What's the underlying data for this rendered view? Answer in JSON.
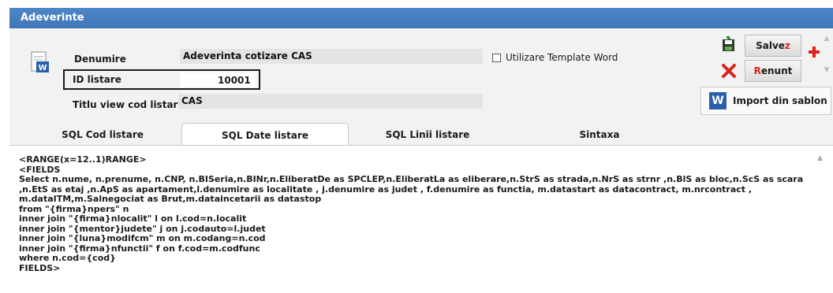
{
  "window": {
    "title": "Adeverinte"
  },
  "form": {
    "denumire_label": "Denumire",
    "denumire_value": "Adeverinta cotizare CAS",
    "id_label": "ID listare",
    "id_value": "10001",
    "titlu_label": "Titlu view cod listare",
    "titlu_value": "CAS",
    "template_label": "Utilizare Template Word",
    "template_checked": false
  },
  "buttons": {
    "save_pre": "Salve",
    "save_hot": "z",
    "cancel_hot": "R",
    "cancel_post": "enunt",
    "import_label": "Import din sablon",
    "import_icon_letter": "W"
  },
  "tabs": [
    {
      "label": "SQL Cod listare",
      "active": false
    },
    {
      "label": "SQL Date listare",
      "active": true
    },
    {
      "label": "SQL Linii listare",
      "active": false
    },
    {
      "label": "Sintaxa",
      "active": false
    }
  ],
  "sql": {
    "lines": [
      "<RANGE(x=12..1)RANGE>",
      "<FIELDS",
      "Select n.nume, n.prenume, n.CNP, n.BISeria,n.BINr,n.EliberatDe as SPCLEP,n.EliberatLa as eliberare,n.StrS as strada,n.NrS as strnr ,n.BlS as bloc,n.ScS as scara ,n.EtS as etaj ,n.ApS as apartament,l.denumire as localitate , j.denumire as judet , f.denumire as functia, m.datastart as datacontract, m.nrcontract , m.dataITM,m.Salnegociat as Brut,m.dataincetarii as datastop",
      "from \"{firma}npers\" n",
      "inner join \"{firma}nlocalit\" l on l.cod=n.localit",
      "inner join \"{mentor}judete\" j on j.codauto=l.judet",
      "inner join \"{luna}modifcm\" m on m.codang=n.cod",
      "inner join \"{firma}nfunctii\" f on f.cod=m.codfunc",
      "where n.cod={cod}",
      "FIELDS>"
    ]
  },
  "colors": {
    "titlebar": "#4577bc",
    "hotkey": "#e0201a",
    "panel": "#f2f2f2"
  }
}
